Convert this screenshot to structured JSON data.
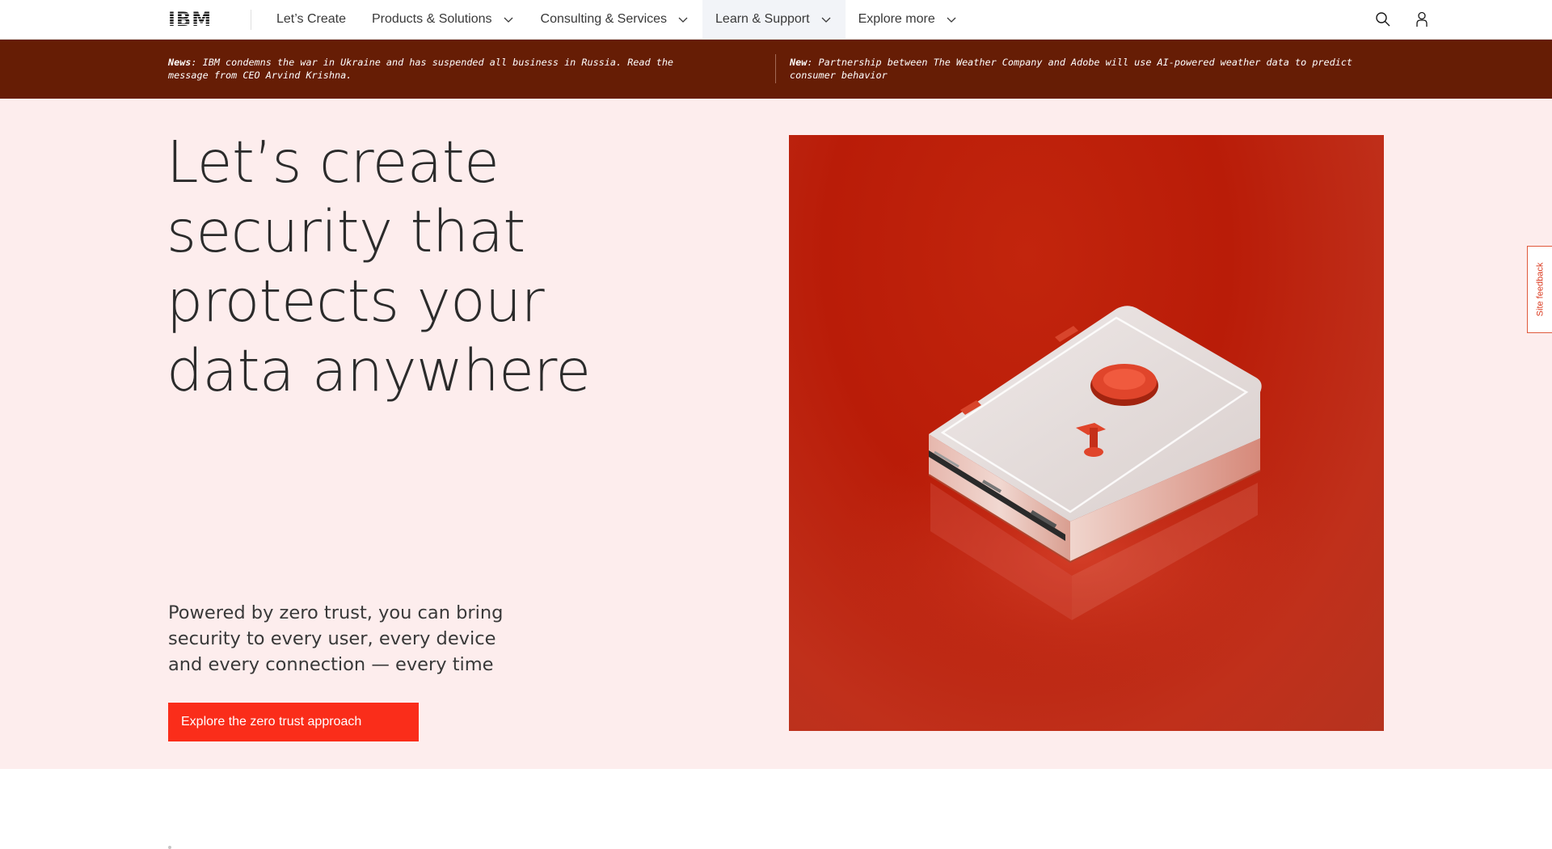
{
  "header": {
    "logo_text": "IBM",
    "nav": [
      {
        "label": "Let’s Create",
        "has_menu": false
      },
      {
        "label": "Products & Solutions",
        "has_menu": true
      },
      {
        "label": "Consulting & Services",
        "has_menu": true
      },
      {
        "label": "Learn & Support",
        "has_menu": true,
        "active": true
      },
      {
        "label": "Explore more",
        "has_menu": true
      }
    ],
    "icons": [
      "search-icon",
      "user-icon"
    ]
  },
  "news": {
    "items": [
      {
        "prefix": "News",
        "text": ": IBM condemns the war in Ukraine and has suspended all business in Russia. Read the message from CEO Arvind Krishna."
      },
      {
        "prefix": "New",
        "text": ": Partnership between The Weather Company and Adobe will use AI-powered weather data to predict consumer behavior"
      }
    ]
  },
  "hero": {
    "title": "Let’s create security that protects your data anywhere",
    "subtitle": "Powered by zero trust, you can bring security to every user, every device and every connection — every time",
    "cta_label": "Explore the zero trust approach"
  },
  "feedback": {
    "label": "Site feedback"
  },
  "colors": {
    "news_band": "#661d05",
    "hero_bg": "#fdeded",
    "cta": "#fa2d1a",
    "hero_image_bg": "#b91c08"
  }
}
